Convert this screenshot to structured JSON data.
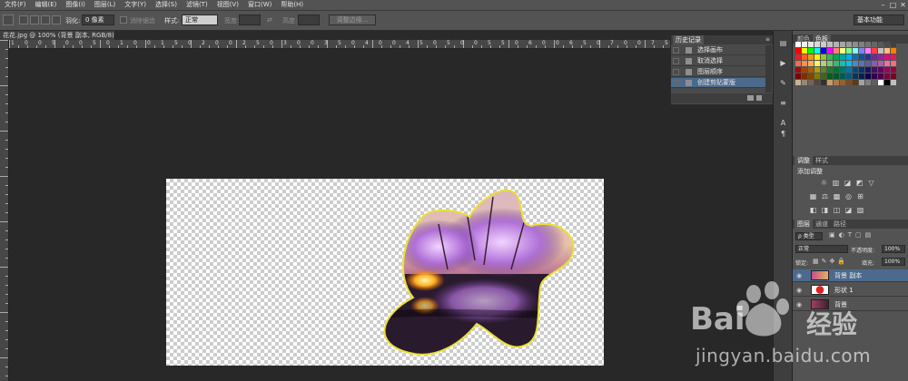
{
  "menu": [
    "文件(F)",
    "编辑(E)",
    "图像(I)",
    "图层(L)",
    "文字(Y)",
    "选择(S)",
    "滤镜(T)",
    "视图(V)",
    "窗口(W)",
    "帮助(H)"
  ],
  "window_controls": [
    "–",
    "□",
    "✕"
  ],
  "options": {
    "feather_label": "羽化:",
    "feather_value": "0 像素",
    "antialias_label": "消除锯齿",
    "style_label": "样式:",
    "style_value": "正常",
    "width_label": "宽度:",
    "height_label": "高度:",
    "refine_button": "调整边缘...",
    "workspace": "基本功能"
  },
  "document": {
    "tab_title": "花花.jpg @ 100% (背景 副本, RGB/8) *",
    "close": "×"
  },
  "ruler": {
    "top_numbers": [
      "1",
      "0",
      "0",
      "5",
      "0",
      "0",
      "5",
      "0",
      "1",
      "0",
      "0",
      "1",
      "5",
      "0",
      "2",
      "0",
      "0",
      "2",
      "5",
      "0",
      "3",
      "0",
      "0",
      "3",
      "5",
      "0",
      "4",
      "0",
      "0",
      "4",
      "5",
      "0",
      "5",
      "0",
      "0",
      "5",
      "5",
      "0",
      "6",
      "0",
      "0",
      "6",
      "5",
      "0",
      "7",
      "0",
      "0",
      "7",
      "5",
      "0",
      "8",
      "0",
      "0",
      "8",
      "5",
      "0"
    ]
  },
  "history": {
    "title": "历史记录",
    "items": [
      {
        "label": "选择画布",
        "active": false
      },
      {
        "label": "取消选择",
        "active": false
      },
      {
        "label": "图层顺序",
        "active": false
      },
      {
        "label": "创建剪贴蒙版",
        "active": true
      }
    ]
  },
  "right_panels": {
    "swatch_tabs": [
      "颜色",
      "色板"
    ],
    "adjust_tabs": [
      "调整",
      "样式"
    ],
    "adjust_title": "添加调整",
    "layers_tabs": [
      "图层",
      "通道",
      "路径"
    ],
    "kind_label": "ρ 类型",
    "blend_mode": "正常",
    "opacity_label": "不透明度:",
    "opacity_value": "100%",
    "lock_label": "锁定:",
    "fill_label": "填充:",
    "fill_value": "100%",
    "layers": [
      {
        "name": "背景 副本",
        "active": true
      },
      {
        "name": "形状 1",
        "active": false
      },
      {
        "name": "背景",
        "active": false
      }
    ]
  },
  "watermark": {
    "brand": "Bai",
    "brand_cn": "经验",
    "url": "jingyan.baidu.com"
  },
  "colors": {
    "accent": "#4b6a8d",
    "swatches": [
      "#ffffff",
      "#f2f2f2",
      "#e6e6e6",
      "#d9d9d9",
      "#cccccc",
      "#bfbfbf",
      "#b3b3b3",
      "#a6a6a6",
      "#999999",
      "#8c8c8c",
      "#808080",
      "#737373",
      "#666666",
      "#595959",
      "#4d4d4d",
      "#404040",
      "#ff0000",
      "#ffff00",
      "#00ff00",
      "#00ffff",
      "#0000ff",
      "#ff00ff",
      "#ff8080",
      "#ffff80",
      "#80ff80",
      "#80ffff",
      "#8080ff",
      "#ff80ff",
      "#ff4040",
      "#c0c0c0",
      "#ffc080",
      "#ff8000",
      "#ee1c24",
      "#f26522",
      "#f7941d",
      "#fff200",
      "#8dc63f",
      "#39b54a",
      "#00a651",
      "#00a99d",
      "#00aeef",
      "#0072bc",
      "#0054a6",
      "#2e3192",
      "#662d91",
      "#92278f",
      "#ec008c",
      "#ed145b",
      "#f26c4f",
      "#f68e55",
      "#fbaf5c",
      "#fff467",
      "#acd372",
      "#7cc576",
      "#3bb878",
      "#1abbb4",
      "#00bff3",
      "#438cca",
      "#5574b9",
      "#605ca8",
      "#855fa8",
      "#a763a8",
      "#f06eaa",
      "#f26d7d",
      "#9e0b0f",
      "#a0410d",
      "#a36209",
      "#aba000",
      "#598527",
      "#1a7b30",
      "#007236",
      "#00746b",
      "#0076a3",
      "#004b80",
      "#003471",
      "#1b1464",
      "#440e62",
      "#630460",
      "#9e005d",
      "#9e0039",
      "#790000",
      "#7b2e00",
      "#7d4900",
      "#827b00",
      "#406618",
      "#005e20",
      "#005826",
      "#005952",
      "#005b7f",
      "#003663",
      "#002157",
      "#0d004c",
      "#32004b",
      "#4b0049",
      "#7b0046",
      "#7a0026",
      "#c7b299",
      "#998675",
      "#736357",
      "#534741",
      "#37302d",
      "#c69c6d",
      "#a67c52",
      "#8c6239",
      "#754c24",
      "#603913",
      "#a3a3a3",
      "#7f7f7f",
      "#5e5e5e",
      "#ffffff",
      "#000000",
      "#c0c0c0"
    ]
  }
}
